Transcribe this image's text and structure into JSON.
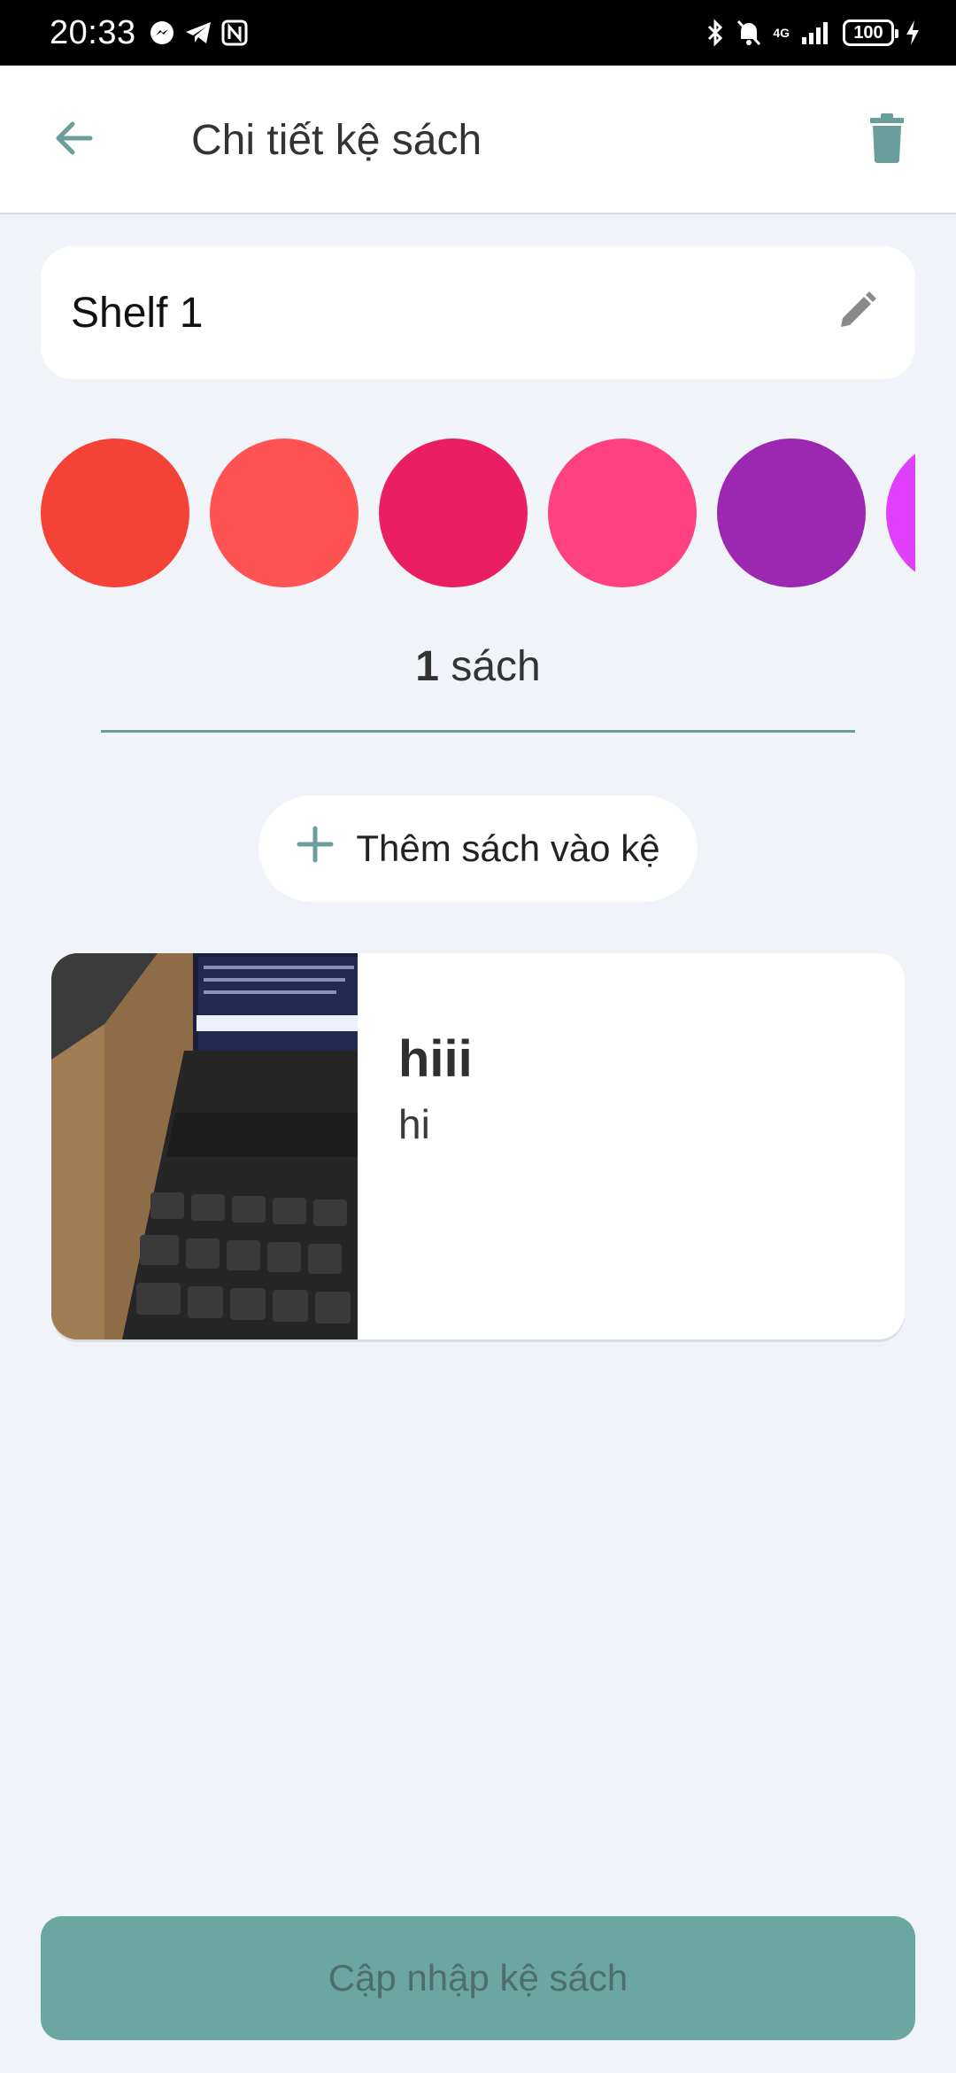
{
  "status_bar": {
    "time": "20:33",
    "network": "4G",
    "battery": "100",
    "icons": [
      "messenger-icon",
      "telegram-icon",
      "nfc-icon",
      "bluetooth-icon",
      "mute-icon",
      "signal-icon",
      "charging-icon"
    ]
  },
  "header": {
    "title": "Chi tiết kệ sách",
    "back_icon": "arrow-left-icon",
    "delete_icon": "trash-icon"
  },
  "shelf": {
    "name": "Shelf 1",
    "edit_icon": "pencil-icon"
  },
  "colors": {
    "accent": "#6ba6a0",
    "swatches": [
      "#f44336",
      "#ff5252",
      "#e91e63",
      "#ff4081",
      "#9c27b0",
      "#e040fb"
    ]
  },
  "count": {
    "number": "1",
    "unit": "sách"
  },
  "add_button": {
    "label": "Thêm sách vào kệ",
    "icon": "plus-icon"
  },
  "books": [
    {
      "title": "hiii",
      "description": "hi"
    }
  ],
  "footer": {
    "update_label": "Cập nhập kệ sách"
  }
}
